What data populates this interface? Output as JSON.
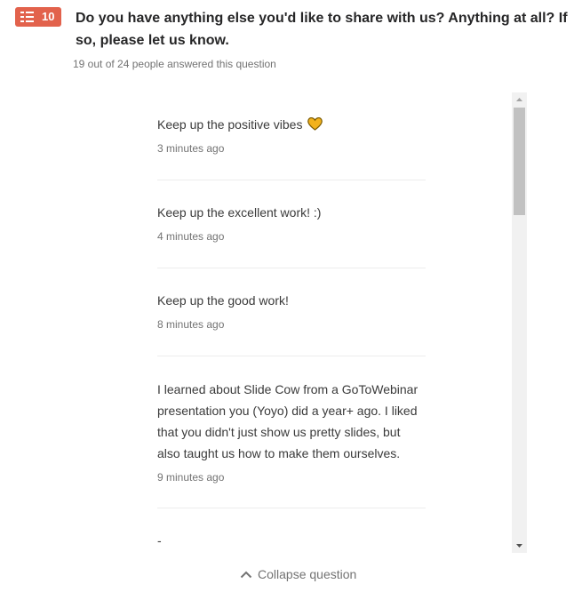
{
  "question": {
    "number": "10",
    "type_icon": "list-icon",
    "title": "Do you have anything else you'd like to share with us? Anything at all? If so, please let us know.",
    "answer_count": "19 out of 24 people answered this question"
  },
  "answers": [
    {
      "text": "Keep up the positive vibes",
      "emoji": "yellow-heart",
      "time": "3 minutes ago"
    },
    {
      "text": "Keep up the excellent work! :)",
      "time": "4 minutes ago"
    },
    {
      "text": "Keep up the good work!",
      "time": "8 minutes ago"
    },
    {
      "text": "I learned about Slide Cow from a GoToWebinar presentation you (Yoyo) did a year+ ago. I liked that you didn't just show us pretty slides, but also taught us how to make them ourselves.",
      "time": "9 minutes ago"
    },
    {
      "text": "-"
    }
  ],
  "collapse_label": "Collapse question",
  "colors": {
    "badge": "#e2624c",
    "muted": "#737373",
    "heart": "#f2b21c"
  }
}
